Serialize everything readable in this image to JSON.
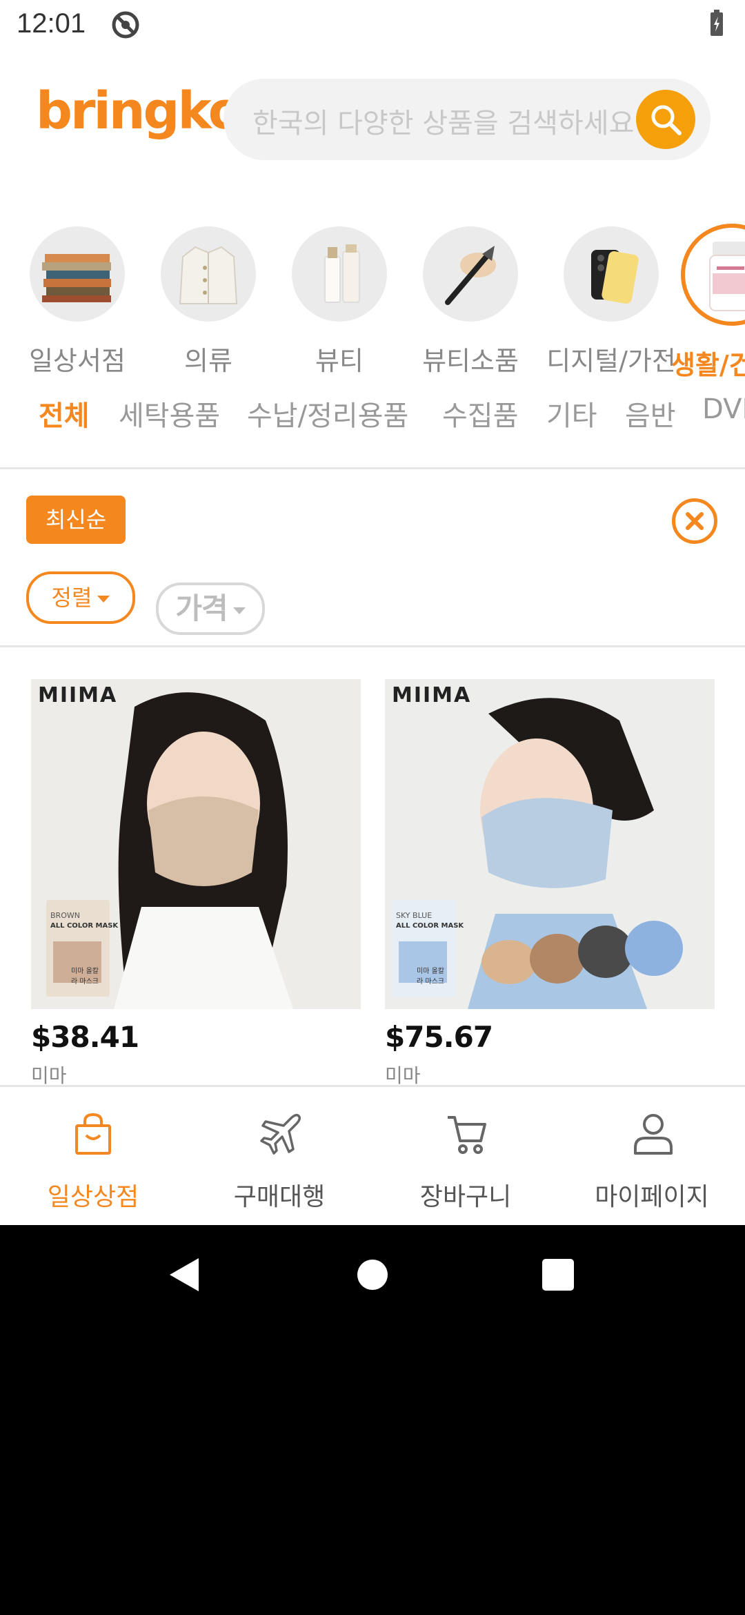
{
  "status": {
    "time": "12:01"
  },
  "header": {
    "logo": "bringko",
    "search_placeholder": "한국의 다양한 상품을 검색하세요"
  },
  "categories": [
    {
      "label": "일상서점",
      "icon": "books-icon"
    },
    {
      "label": "의류",
      "icon": "jacket-icon"
    },
    {
      "label": "뷰티",
      "icon": "cosmetics-icon"
    },
    {
      "label": "뷰티소품",
      "icon": "makeup-brush-icon"
    },
    {
      "label": "디지털/가전",
      "icon": "phone-icon"
    },
    {
      "label": "생활/건",
      "icon": "supplement-icon",
      "active": true
    }
  ],
  "subtabs": [
    "전체",
    "세탁용품",
    "수납/정리용품",
    "수집품",
    "기타",
    "음반",
    "DVD"
  ],
  "filter": {
    "selected_chip": "최신순",
    "sort_label": "정렬",
    "price_label": "가격"
  },
  "products": [
    {
      "price": "$38.41",
      "brand": "미마",
      "logo_text": "MIIMA",
      "pack_color": "BROWN",
      "pack_text": "ALL COLOR MASK",
      "pack_kr": "미마 올칼라 마스크"
    },
    {
      "price": "$75.67",
      "brand": "미마",
      "logo_text": "MIIMA",
      "pack_color": "SKY BLUE",
      "pack_text": "ALL COLOR MASK",
      "pack_kr": "미마 올칼라 마스크"
    }
  ],
  "bottom_nav": [
    {
      "label": "일상상점",
      "icon": "shopping-bag-icon",
      "active": true
    },
    {
      "label": "구매대행",
      "icon": "airplane-icon"
    },
    {
      "label": "장바구니",
      "icon": "cart-icon"
    },
    {
      "label": "마이페이지",
      "icon": "user-icon"
    }
  ],
  "colors": {
    "accent": "#F5871F",
    "search_button": "#F5A00B"
  }
}
